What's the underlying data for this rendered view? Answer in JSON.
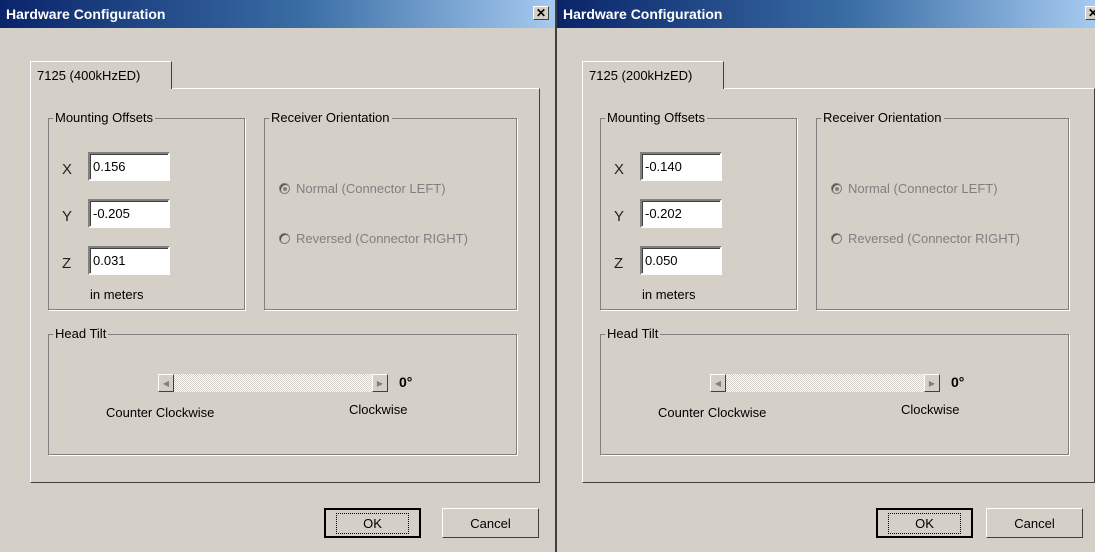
{
  "dialogs": [
    {
      "title": "Hardware Configuration",
      "tab_label": "7125 (400kHzED)",
      "mounting_offsets": {
        "legend": "Mounting Offsets",
        "x_label": "X",
        "x_value": "0.156",
        "y_label": "Y",
        "y_value": "-0.205",
        "z_label": "Z",
        "z_value": "0.031",
        "units": "in meters"
      },
      "receiver_orientation": {
        "legend": "Receiver Orientation",
        "normal_label": "Normal  (Connector LEFT)",
        "reversed_label": "Reversed  (Connector RIGHT)",
        "selected": "normal"
      },
      "head_tilt": {
        "legend": "Head Tilt",
        "value": "0°",
        "ccw_label": "Counter Clockwise",
        "cw_label": "Clockwise"
      },
      "ok_label": "OK",
      "cancel_label": "Cancel"
    },
    {
      "title": "Hardware Configuration",
      "tab_label": "7125 (200kHzED)",
      "mounting_offsets": {
        "legend": "Mounting Offsets",
        "x_label": "X",
        "x_value": "-0.140",
        "y_label": "Y",
        "y_value": "-0.202",
        "z_label": "Z",
        "z_value": "0.050",
        "units": "in meters"
      },
      "receiver_orientation": {
        "legend": "Receiver Orientation",
        "normal_label": "Normal  (Connector LEFT)",
        "reversed_label": "Reversed  (Connector RIGHT)",
        "selected": "normal"
      },
      "head_tilt": {
        "legend": "Head Tilt",
        "value": "0°",
        "ccw_label": "Counter Clockwise",
        "cw_label": "Clockwise"
      },
      "ok_label": "OK",
      "cancel_label": "Cancel"
    }
  ],
  "icons": {
    "close": "close-icon",
    "scroll_left": "scroll-left-arrow-icon",
    "scroll_right": "scroll-right-arrow-icon"
  },
  "colors": {
    "title_gradient_start": "#0a246a",
    "title_gradient_end": "#a6caf0",
    "dialog_face": "#d4d0c8",
    "disabled_text": "#808080"
  }
}
